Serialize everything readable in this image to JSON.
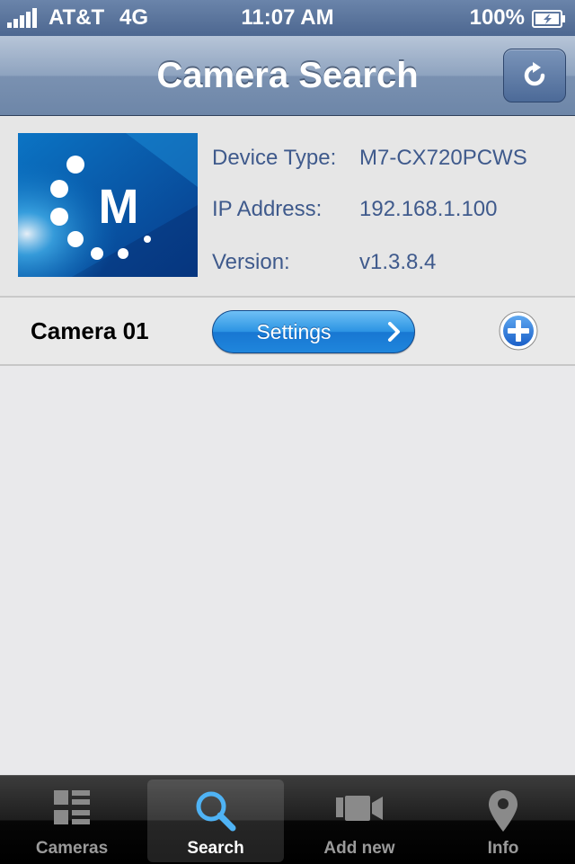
{
  "status_bar": {
    "carrier": "AT&T",
    "network": "4G",
    "time": "11:07 AM",
    "battery": "100%"
  },
  "nav": {
    "title": "Camera Search",
    "refresh_icon": "refresh-icon"
  },
  "device": {
    "logo_letter": "M",
    "fields": [
      {
        "label": "Device Type:",
        "value": "M7-CX720PCWS"
      },
      {
        "label": "IP Address:",
        "value": "192.168.1.100"
      },
      {
        "label": "Version:",
        "value": "v1.3.8.4"
      }
    ]
  },
  "camera": {
    "name": "Camera 01",
    "settings_label": "Settings",
    "add_icon": "plus-circle-icon"
  },
  "tabs": [
    {
      "label": "Cameras",
      "icon": "grid-list-icon",
      "active": false
    },
    {
      "label": "Search",
      "icon": "search-icon",
      "active": true
    },
    {
      "label": "Add new",
      "icon": "video-camera-icon",
      "active": false
    },
    {
      "label": "Info",
      "icon": "map-pin-icon",
      "active": false
    }
  ],
  "colors": {
    "nav_bar": "#7a91b1",
    "info_text": "#3f5a8c",
    "settings_button": "#2b93e3",
    "tab_active": "#ffffff",
    "tab_inactive": "#9a9a9a"
  }
}
